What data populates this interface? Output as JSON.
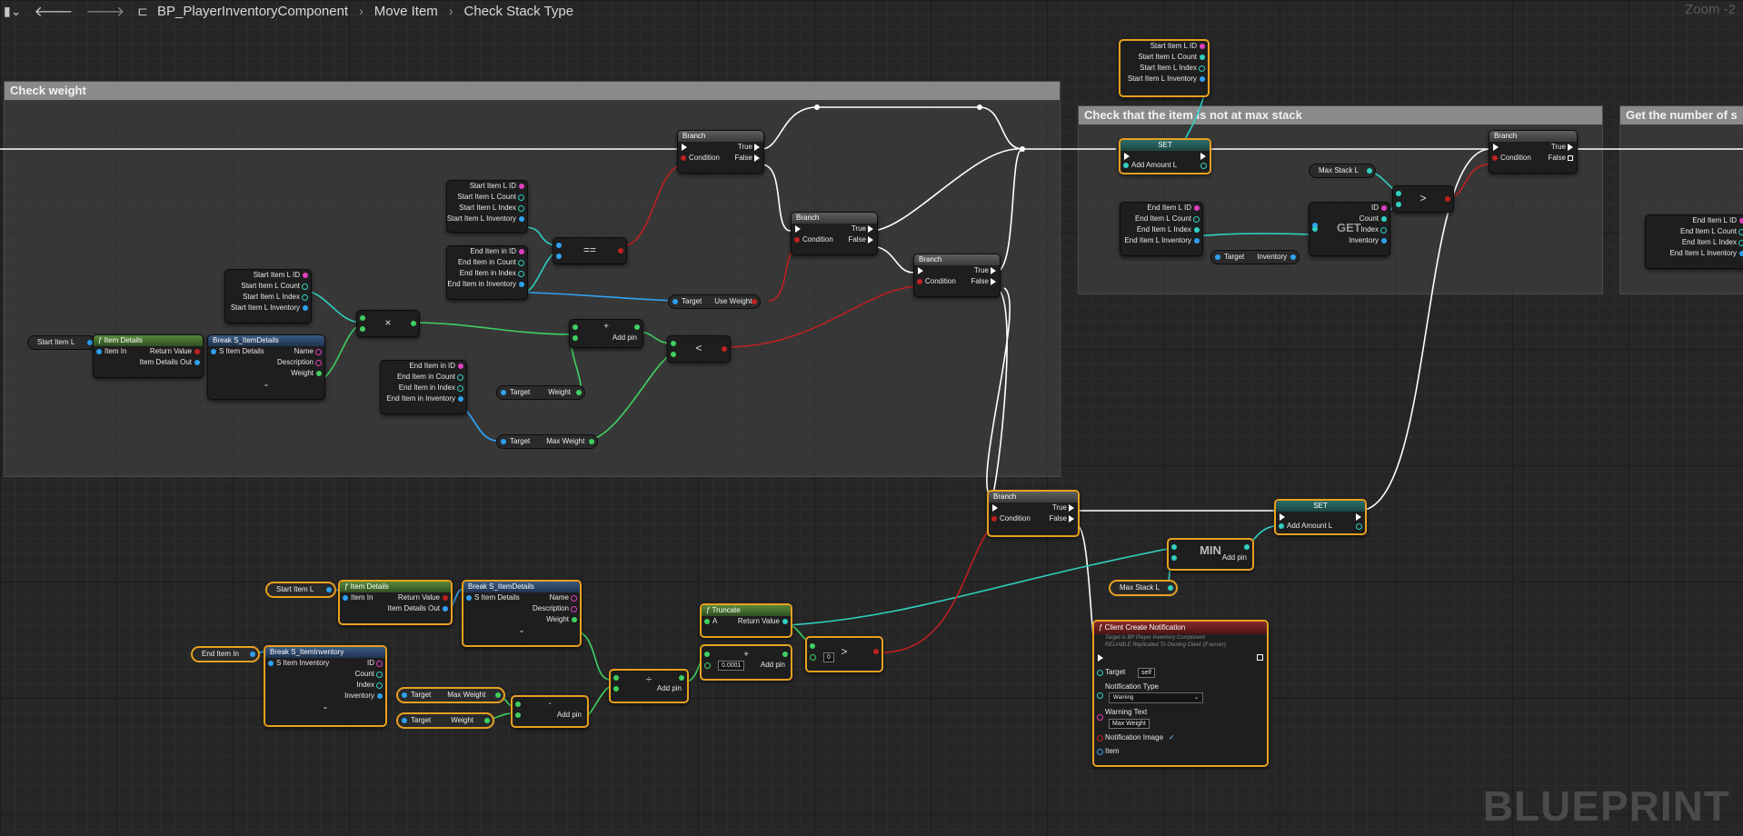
{
  "toolbar": {
    "history_icon": "bookmark-icon",
    "back_icon": "back-arrow-icon",
    "forward_icon": "forward-arrow-icon",
    "breadcrumb": [
      "BP_PlayerInventoryComponent",
      "Move Item",
      "Check Stack Type"
    ],
    "zoom": "Zoom -2"
  },
  "watermark": "BLUEPRINT",
  "comments": {
    "check_weight": "Check weight",
    "max_stack": "Check that the item is not at max stack",
    "get_number": "Get the number of s"
  },
  "labels": {
    "branch": "Branch",
    "true": "True",
    "false": "False",
    "condition": "Condition",
    "set": "SET",
    "add_amount_l": "Add Amount L",
    "start_item_l_id": "Start Item L ID",
    "start_item_l_count": "Start Item L Count",
    "start_item_l_index": "Start Item L Index",
    "start_item_l_inventory": "Start Item L Inventory",
    "end_item_l_id": "End Item L ID",
    "end_item_l_count": "End Item L Count",
    "end_item_l_index": "End Item L Index",
    "end_item_l_inventory": "End Item L Inventory",
    "end_item_in_id": "End Item in ID",
    "end_item_in_count": "End Item in Count",
    "end_item_in_index": "End Item in Index",
    "end_item_in_inventory": "End Item in Inventory",
    "start_item_l": "Start Item L",
    "end_item_in": "End Item In",
    "item_details": "Item Details",
    "item_in": "Item In",
    "return_value": "Return Value",
    "item_details_out": "Item Details Out",
    "break_details": "Break S_ItemDetails",
    "s_item_details": "S Item Details",
    "name": "Name",
    "description": "Description",
    "weight": "Weight",
    "target": "Target",
    "max_weight": "Max Weight",
    "use_weight": "Use Weight",
    "add_pin": "Add pin",
    "max_stack_l": "Max Stack L",
    "get": "GET",
    "id": "ID",
    "count": "Count",
    "index": "Index",
    "inventory": "Inventory",
    "min": "MIN",
    "truncate": "Truncate",
    "a": "A",
    "break_inventory": "Break S_ItemInventory",
    "s_item_inventory": "S Item Inventory",
    "small_value": "0.0001",
    "zero": "0",
    "client_notification": "Client Create Notification",
    "notif_note1": "Target is BP Player Inventory Component",
    "notif_note2": "RELIABLE Replicated To Owning Client (if server)",
    "self": "self",
    "notification_type": "Notification Type",
    "warning": "Warning",
    "warning_text": "Warning Text",
    "notification_image": "Notification Image",
    "item": "Item",
    "op_eq": "==",
    "op_mul": "×",
    "op_add": "+",
    "op_lt": "<",
    "op_gt": ">",
    "op_div": "÷",
    "op_sub": "-"
  }
}
